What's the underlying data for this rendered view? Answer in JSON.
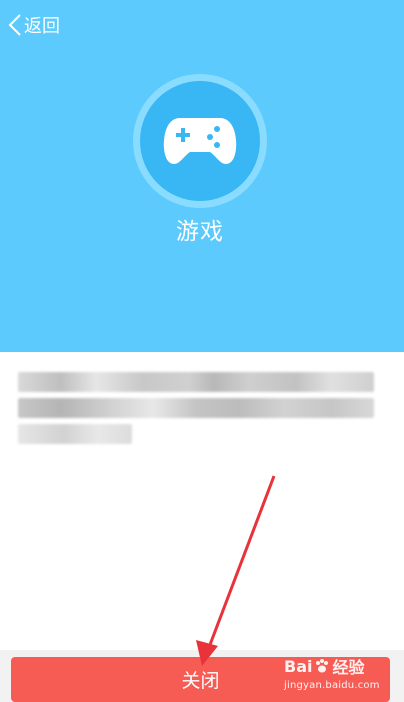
{
  "header": {
    "back_label": "返回",
    "background_color": "#5ccafc"
  },
  "app": {
    "icon": "gamepad-icon",
    "title": "游戏"
  },
  "description": {
    "content": "blurred-text"
  },
  "footer": {
    "close_label": "关闭",
    "close_color": "#f75c54"
  },
  "watermark": {
    "logo_prefix": "Bai",
    "logo_suffix": "经验",
    "url": "jingyan.baidu.com"
  },
  "annotation": {
    "arrow_color": "#e8333a"
  }
}
